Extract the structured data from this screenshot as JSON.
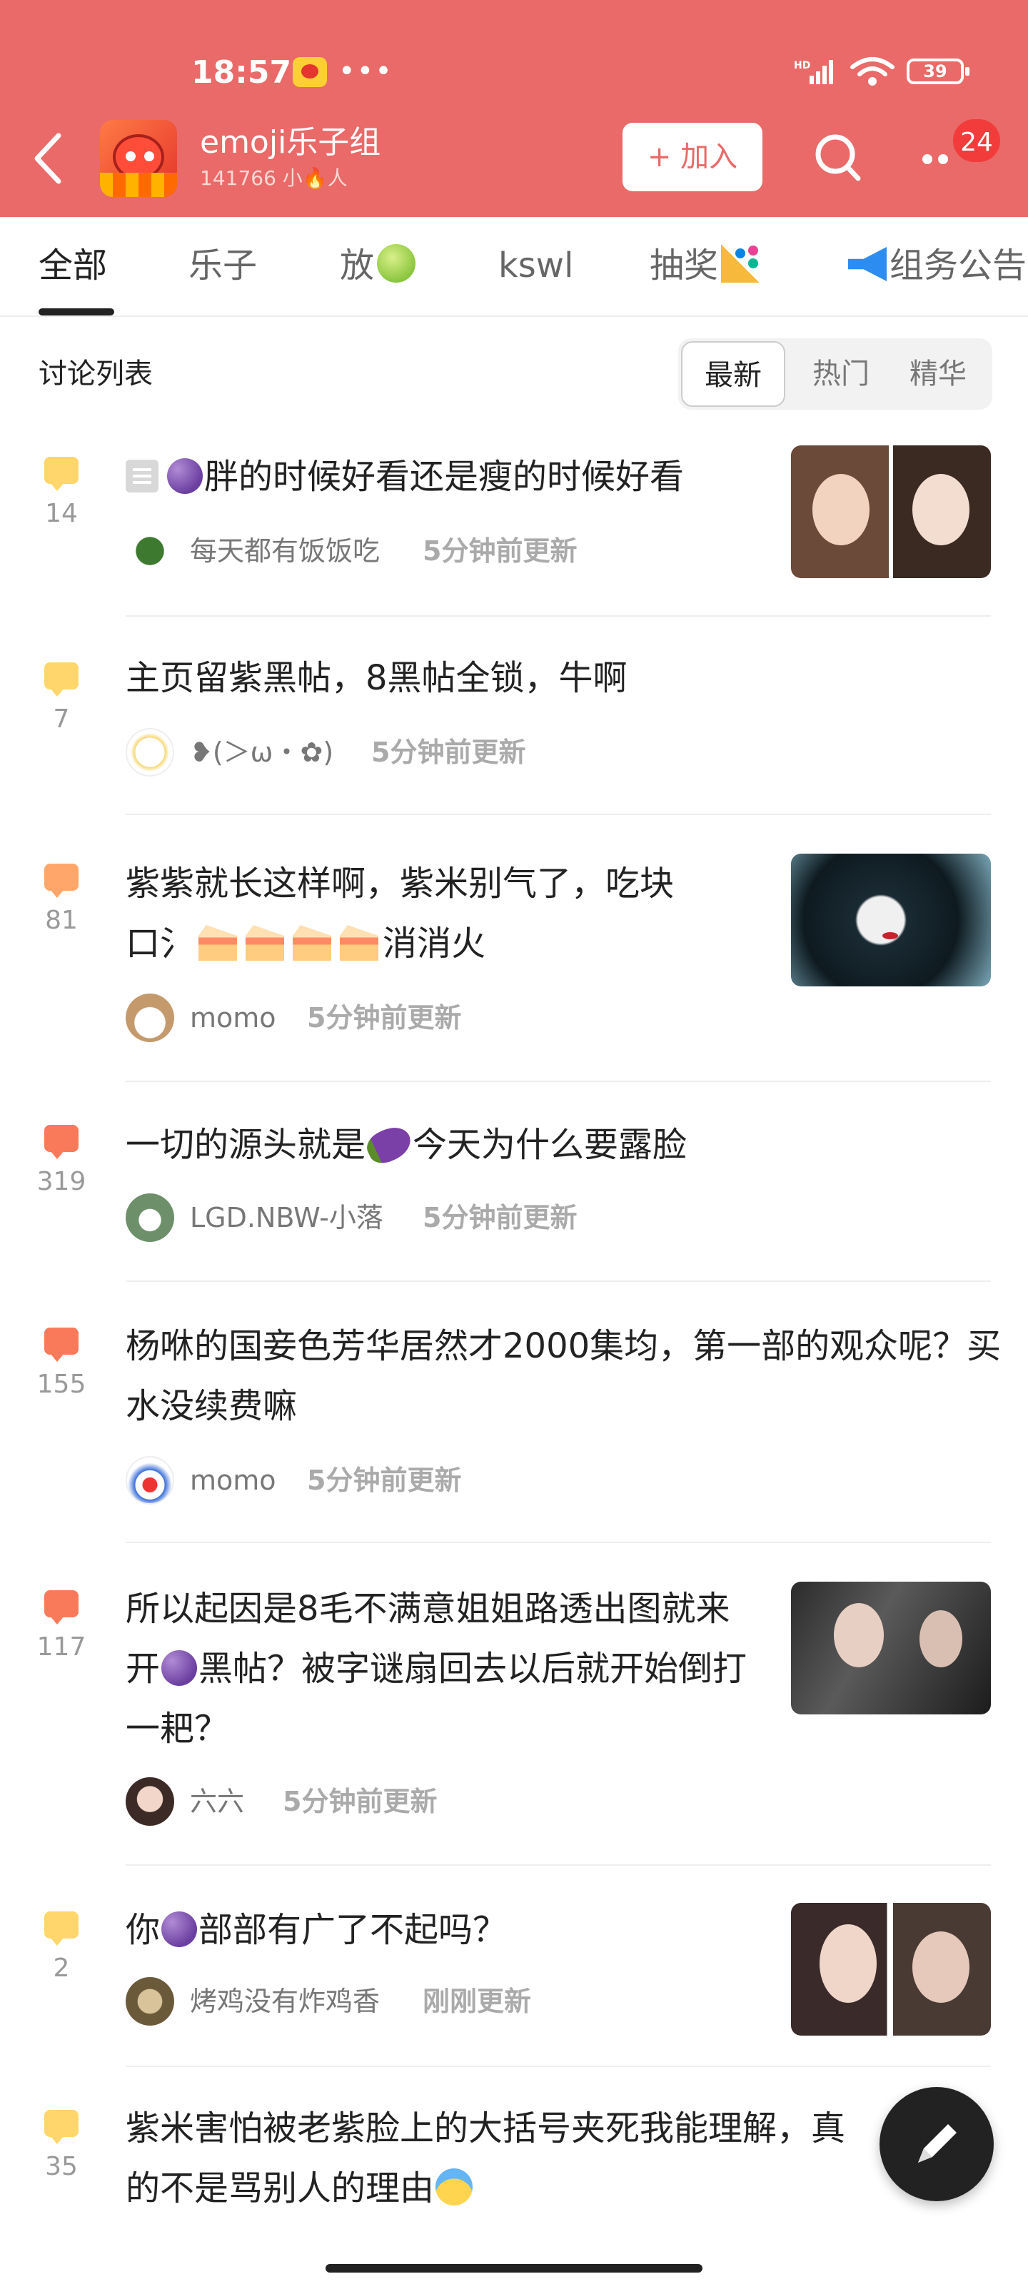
{
  "status_bar": {
    "time": "18:57",
    "more": "•••",
    "network": "HD",
    "battery": "39"
  },
  "header": {
    "group_name": "emoji乐子组",
    "member_text": "141766 小🔥人",
    "join_label": "+ 加入",
    "notification_count": "24"
  },
  "tabs": [
    {
      "label": "全部"
    },
    {
      "label": "乐子"
    },
    {
      "label": "放"
    },
    {
      "label": "kswl"
    },
    {
      "label": "抽奖"
    },
    {
      "label": "组务公告"
    }
  ],
  "list": {
    "title": "讨论列表",
    "sort": [
      "最新",
      "热门",
      "精华"
    ]
  },
  "posts": [
    {
      "count": "14",
      "title": "胖的时候好看还是瘦的时候好看",
      "author": "每天都有饭饭吃",
      "time": "5分钟前更新"
    },
    {
      "count": "7",
      "title": "主页留紫黑帖，8黑帖全锁，牛啊",
      "author": "❥(＞ω・✿)",
      "time": "5分钟前更新"
    },
    {
      "count": "81",
      "title_a": "紫紫就长这样啊，紫米别气了，吃块",
      "title_b": "口氵",
      "title_c": "消消火",
      "author": "momo",
      "time": "5分钟前更新"
    },
    {
      "count": "319",
      "title_a": "一切的源头就是",
      "title_b": "今天为什么要露脸",
      "author": "LGD.NBW-小落",
      "time": "5分钟前更新"
    },
    {
      "count": "155",
      "title": "杨咻的国妾色芳华居然才2000集均，第一部的观众呢？买水没续费嘛",
      "author": "momo",
      "time": "5分钟前更新"
    },
    {
      "count": "117",
      "title_a": "所以起因是8毛不满意姐姐路透出图就来开",
      "title_b": "黑帖？被字谜扇回去以后就开始倒打一耙？",
      "author": "六六",
      "time": "5分钟前更新"
    },
    {
      "count": "2",
      "title_a": "你",
      "title_b": "部部有广了不起吗？",
      "author": "烤鸡没有炸鸡香",
      "time": "刚刚更新"
    },
    {
      "count": "35",
      "title": "紫米害怕被老紫脸上的大括号夹死我能理解，真的不是骂别人的理由",
      "author": "",
      "time": ""
    }
  ],
  "colors": {
    "brand": "#e96a68",
    "badge": "#f23b3b"
  },
  "icons": [
    "back-arrow-icon",
    "search-icon",
    "more-icon",
    "comment-bubble-icon",
    "pen-icon"
  ]
}
